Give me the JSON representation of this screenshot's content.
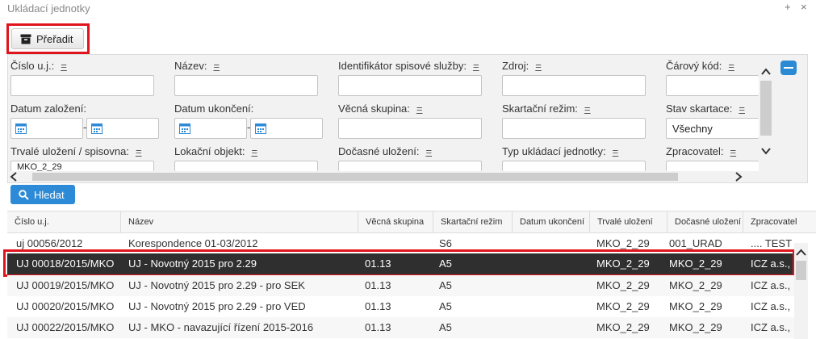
{
  "window": {
    "title": "Ukládací jednotky",
    "plus": "+",
    "close": "×"
  },
  "toolbar": {
    "move_label": "Přeřadit",
    "icon": "archive-box-icon"
  },
  "filters": {
    "eq": "=",
    "cislo_uj": {
      "label": "Číslo u.j.:",
      "value": ""
    },
    "nazev": {
      "label": "Název:",
      "value": ""
    },
    "identifikator": {
      "label": "Identifikátor spisové služby:",
      "value": ""
    },
    "zdroj": {
      "label": "Zdroj:",
      "value": ""
    },
    "carovy_kod": {
      "label": "Čárový kód:",
      "value": ""
    },
    "datum_zalozeni": {
      "label": "Datum založení:"
    },
    "datum_ukonceni": {
      "label": "Datum ukončení:"
    },
    "vecna_skupina": {
      "label": "Věcná skupina:",
      "value": ""
    },
    "skartacni_rezim": {
      "label": "Skartační režim:",
      "value": ""
    },
    "stav_skartace": {
      "label": "Stav skartace:",
      "value": "Všechny"
    },
    "trvale_ulozeni": {
      "label": "Trvalé uložení / spisovna:",
      "value": "MKO_2_29"
    },
    "lokacni_objekt": {
      "label": "Lokační objekt:"
    },
    "docasne_ulozeni": {
      "label": "Dočasné uložení:"
    },
    "typ_uj": {
      "label": "Typ ukládací jednotky:"
    },
    "zpracovatel": {
      "label": "Zpracovatel:"
    },
    "date_separator": "-"
  },
  "search": {
    "label": "Hledat",
    "icon": "magnifier-icon"
  },
  "colors": {
    "accent": "#2d8ad6",
    "highlight": "#e0141c",
    "selected_row": "#2f2f2f"
  },
  "table": {
    "columns": [
      "Číslo u.j.",
      "Název",
      "Věcná skupina",
      "Skartační režim",
      "Datum ukončení",
      "Trvalé uložení",
      "Dočasné uložení",
      "Zpracovatel"
    ],
    "rows": [
      [
        "uj 00056/2012",
        "Korespondence 01-03/2012",
        "",
        "S6",
        "",
        "MKO_2_29",
        "001_URAD",
        ".... TEST"
      ],
      [
        "UJ 00018/2015/MKO",
        "UJ - Novotný 2015 pro 2.29",
        "01.13",
        "A5",
        "",
        "MKO_2_29",
        "MKO_2_29",
        "ICZ a.s.,"
      ],
      [
        "UJ 00019/2015/MKO",
        "UJ - Novotný 2015 pro 2.29 - pro SEK",
        "01.13",
        "A5",
        "",
        "MKO_2_29",
        "MKO_2_29",
        "ICZ a.s.,"
      ],
      [
        "UJ 00020/2015/MKO",
        "UJ - Novotný 2015 pro 2.29 - pro VED",
        "01.13",
        "A5",
        "",
        "MKO_2_29",
        "MKO_2_29",
        "ICZ a.s.,"
      ],
      [
        "UJ 00022/2015/MKO",
        "UJ - MKO - navazující řízení 2015-2016",
        "01.13",
        "A5",
        "",
        "MKO_2_29",
        "MKO_2_29",
        "ICZ a.s.,"
      ]
    ],
    "selected_row": 2
  }
}
